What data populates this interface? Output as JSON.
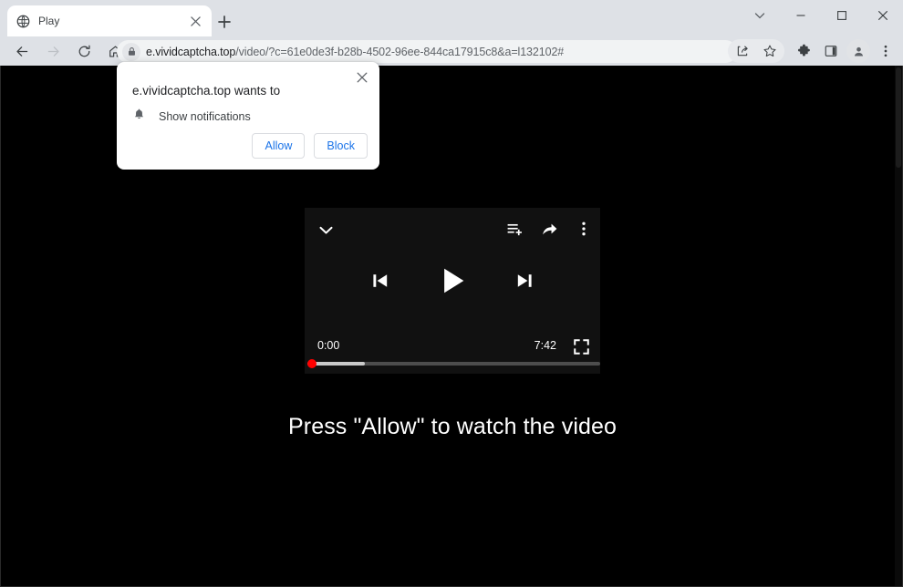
{
  "window": {
    "controls": [
      {
        "name": "tab-search",
        "icon": "chevron-down-icon",
        "label": "Search tabs"
      },
      {
        "name": "minimize",
        "icon": "minimize-icon",
        "label": "Minimize"
      },
      {
        "name": "maximize",
        "icon": "maximize-icon",
        "label": "Maximize"
      },
      {
        "name": "close",
        "icon": "close-icon",
        "label": "Close"
      }
    ]
  },
  "tabstrip": {
    "tabs": [
      {
        "title": "Play",
        "favicon": "globe-icon",
        "close_label": "Close tab"
      }
    ],
    "new_tab_label": "New tab"
  },
  "toolbar": {
    "back_label": "Back",
    "forward_label": "Forward",
    "reload_label": "Reload",
    "home_label": "Home",
    "omnibox": {
      "lock_icon": "lock-icon",
      "host": "e.vividcaptcha.top",
      "path": "/video/?c=61e0de3f-b28b-4502-96ee-844ca17915c8&a=l132102#",
      "full_url": "e.vividcaptcha.top/video/?c=61e0de3f-b28b-4502-96ee-844ca17915c8&a=l132102#"
    },
    "right_icons": [
      {
        "name": "share-page-icon",
        "label": "Share this page"
      },
      {
        "name": "bookmark-star-icon",
        "label": "Bookmark this tab"
      },
      {
        "name": "extensions-puzzle-icon",
        "label": "Extensions"
      },
      {
        "name": "side-panel-icon",
        "label": "Side panel"
      },
      {
        "name": "profile-avatar-icon",
        "label": "Profile"
      },
      {
        "name": "browser-menu-icon",
        "label": "Customize and control Google Chrome"
      }
    ]
  },
  "permission_dialog": {
    "title": "e.vividcaptcha.top wants to",
    "permission_icon": "bell-icon",
    "permission_label": "Show notifications",
    "allow_label": "Allow",
    "block_label": "Block",
    "close_label": "Close",
    "accent_color": "#1a73e8"
  },
  "page": {
    "background_color": "#000000",
    "headline": "Press \"Allow\" to watch the video",
    "player": {
      "background_color": "#111111",
      "collapse_icon": "chevron-down-icon",
      "top_icons": [
        {
          "name": "add-to-queue-icon",
          "label": "Add to queue"
        },
        {
          "name": "share-icon",
          "label": "Share"
        },
        {
          "name": "more-options-icon",
          "label": "More options"
        }
      ],
      "transport": [
        {
          "name": "previous-track-button",
          "label": "Previous"
        },
        {
          "name": "play-button",
          "label": "Play"
        },
        {
          "name": "next-track-button",
          "label": "Next"
        }
      ],
      "current_time": "0:00",
      "duration": "7:42",
      "fullscreen_label": "Full screen",
      "progress_percent": 0,
      "buffered_percent": 20,
      "scrubber_color": "#ff0000"
    }
  }
}
